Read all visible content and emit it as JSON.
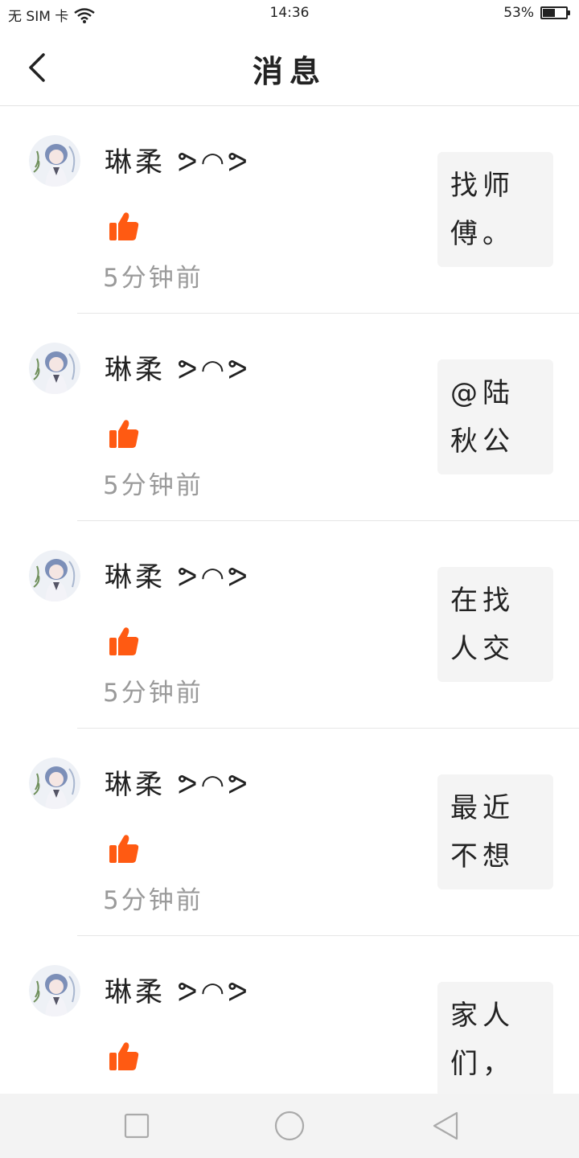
{
  "status_bar": {
    "carrier": "无 SIM 卡",
    "time": "14:36",
    "battery": "53%",
    "battery_level": 0.53
  },
  "header": {
    "title": "消息"
  },
  "messages": [
    {
      "username": "琳柔 ᕗ◠ᕗ",
      "time": "5分钟前",
      "preview": "找师傅。"
    },
    {
      "username": "琳柔 ᕗ◠ᕗ",
      "time": "5分钟前",
      "preview": "@陆秋公"
    },
    {
      "username": "琳柔 ᕗ◠ᕗ",
      "time": "5分钟前",
      "preview": "在找人交"
    },
    {
      "username": "琳柔 ᕗ◠ᕗ",
      "time": "5分钟前",
      "preview": "最近不想"
    },
    {
      "username": "琳柔 ᕗ◠ᕗ",
      "time": "",
      "preview": "家人们，"
    }
  ],
  "colors": {
    "like": "#ff5a12",
    "time": "#9a9a9a",
    "preview_bg": "#f4f4f4"
  }
}
